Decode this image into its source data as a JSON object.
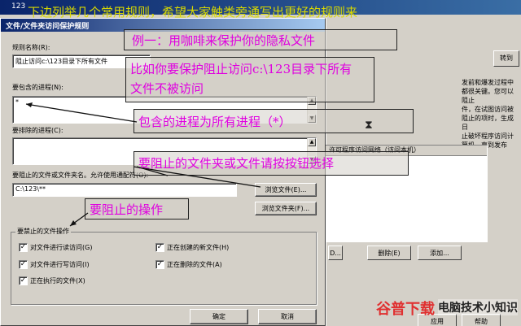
{
  "bg_window": {
    "title": "123",
    "side_button": "转到",
    "desc_lines": [
      "发前和爆发过程中都很关键。您可以阻止",
      "件，在试图访问被阻止的项时，生成日",
      "止破坏程序访问计算机，直到发布 DAT"
    ],
    "list_header": "许可程序访问网络（访问本机）",
    "buttons": {
      "edit": "D...",
      "delete": "删除(E)",
      "add": "添加..."
    },
    "footer": {
      "apply": "应用",
      "help": "帮助"
    }
  },
  "dialog": {
    "title": "文件/文件夹访问保护规则",
    "rule_name_label": "规则名称(R):",
    "rule_name_value": "阻止访问c:\\123目录下所有文件",
    "include_label": "要包含的进程(N):",
    "include_value": "*",
    "exclude_label": "要排除的进程(C):",
    "exclude_value": "",
    "path_label": "要阻止的文件或文件夹名。允许使用通配符(O):",
    "path_value": "C:\\123\\**",
    "browse_file_button": "浏览文件(E)...",
    "browse_folder_button": "浏览文件夹(F)...",
    "group_label": "要禁止的文件操作",
    "operations": [
      {
        "label": "对文件进行读访问(G)",
        "checked": true
      },
      {
        "label": "对文件进行写访问(I)",
        "checked": true
      },
      {
        "label": "正在执行的文件(X)",
        "checked": true
      },
      {
        "label": "正在创建的新文件(H)",
        "checked": true
      },
      {
        "label": "正在删除的文件(A)",
        "checked": true
      }
    ],
    "ok_button": "确定",
    "cancel_button": "取消"
  },
  "annotations": {
    "top_banner": "下边列举几个常用规则，希望大家触类旁通写出更好的规则来",
    "example1": "例一：用咖啡来保护你的隐私文件",
    "explain_line1": "比如你要保护阻止访问c:\\123目录下所有",
    "explain_line2": "文件不被访问",
    "include_note": "包含的进程为所有进程（*）",
    "select_note": "要阻止的文件夹或文件请按按钮选择",
    "operation_note": "要阻止的操作"
  },
  "watermark": {
    "left": "谷普下载",
    "right": "电脑技术小知识"
  }
}
